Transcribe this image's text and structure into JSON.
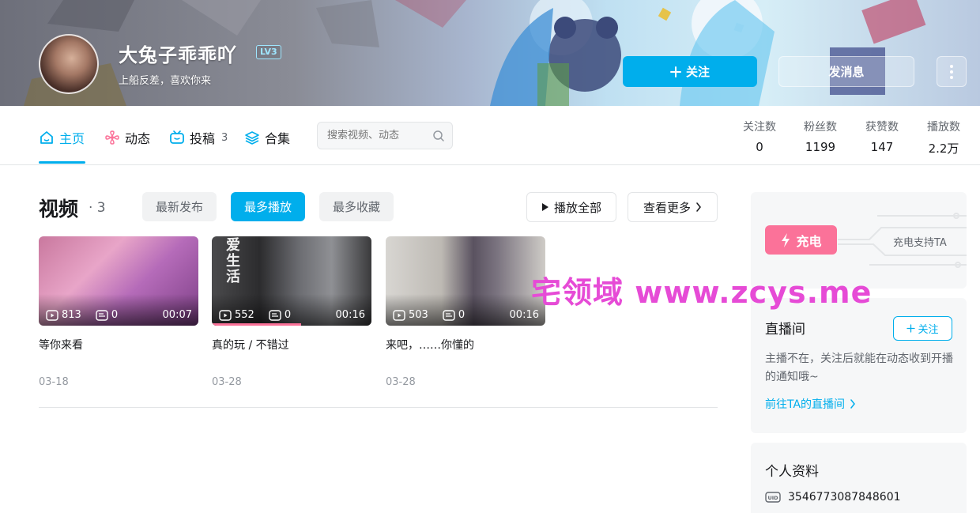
{
  "header": {
    "username": "大兔子乖乖吖",
    "level": "LV3",
    "signature": "上船反差，喜欢你来",
    "follow_label": "关注",
    "message_label": "发消息"
  },
  "nav": {
    "tabs": [
      {
        "label": "主页",
        "count": ""
      },
      {
        "label": "动态",
        "count": ""
      },
      {
        "label": "投稿",
        "count": "3"
      },
      {
        "label": "合集",
        "count": ""
      }
    ],
    "search_placeholder": "搜索视频、动态",
    "stats": [
      {
        "label": "关注数",
        "value": "0"
      },
      {
        "label": "粉丝数",
        "value": "1199"
      },
      {
        "label": "获赞数",
        "value": "147"
      },
      {
        "label": "播放数",
        "value": "2.2万"
      }
    ]
  },
  "videos": {
    "title": "视频",
    "count_text": "· 3",
    "filters": [
      "最新发布",
      "最多播放",
      "最多收藏"
    ],
    "play_all_label": "播放全部",
    "view_more_label": "查看更多",
    "items": [
      {
        "plays": "813",
        "comments": "0",
        "duration": "00:07",
        "title": "等你来看",
        "date": "03-18",
        "watch_progress": 0
      },
      {
        "plays": "552",
        "comments": "0",
        "duration": "00:16",
        "title": "真的玩 / 不错过",
        "date": "03-28",
        "watch_progress": 0.56
      },
      {
        "plays": "503",
        "comments": "0",
        "duration": "00:16",
        "title": "来吧，……你懂的",
        "date": "03-28",
        "watch_progress": 0
      }
    ]
  },
  "thumb_texts": {
    "item2_overlay": "爱生活"
  },
  "watermark": "宅领域 www.zcys.me",
  "sidebar": {
    "charge": {
      "button_label": "充电",
      "text": "充电支持TA"
    },
    "live": {
      "title": "直播间",
      "follow_label": "关注",
      "description": "主播不在，关注后就能在动态收到开播的通知哦~",
      "link": "前往TA的直播间"
    },
    "profile": {
      "title": "个人资料",
      "uid": "3546773087848601"
    }
  },
  "colors": {
    "accent": "#00aeec",
    "pink": "#fb7299",
    "watermark": "#e64bd6"
  }
}
